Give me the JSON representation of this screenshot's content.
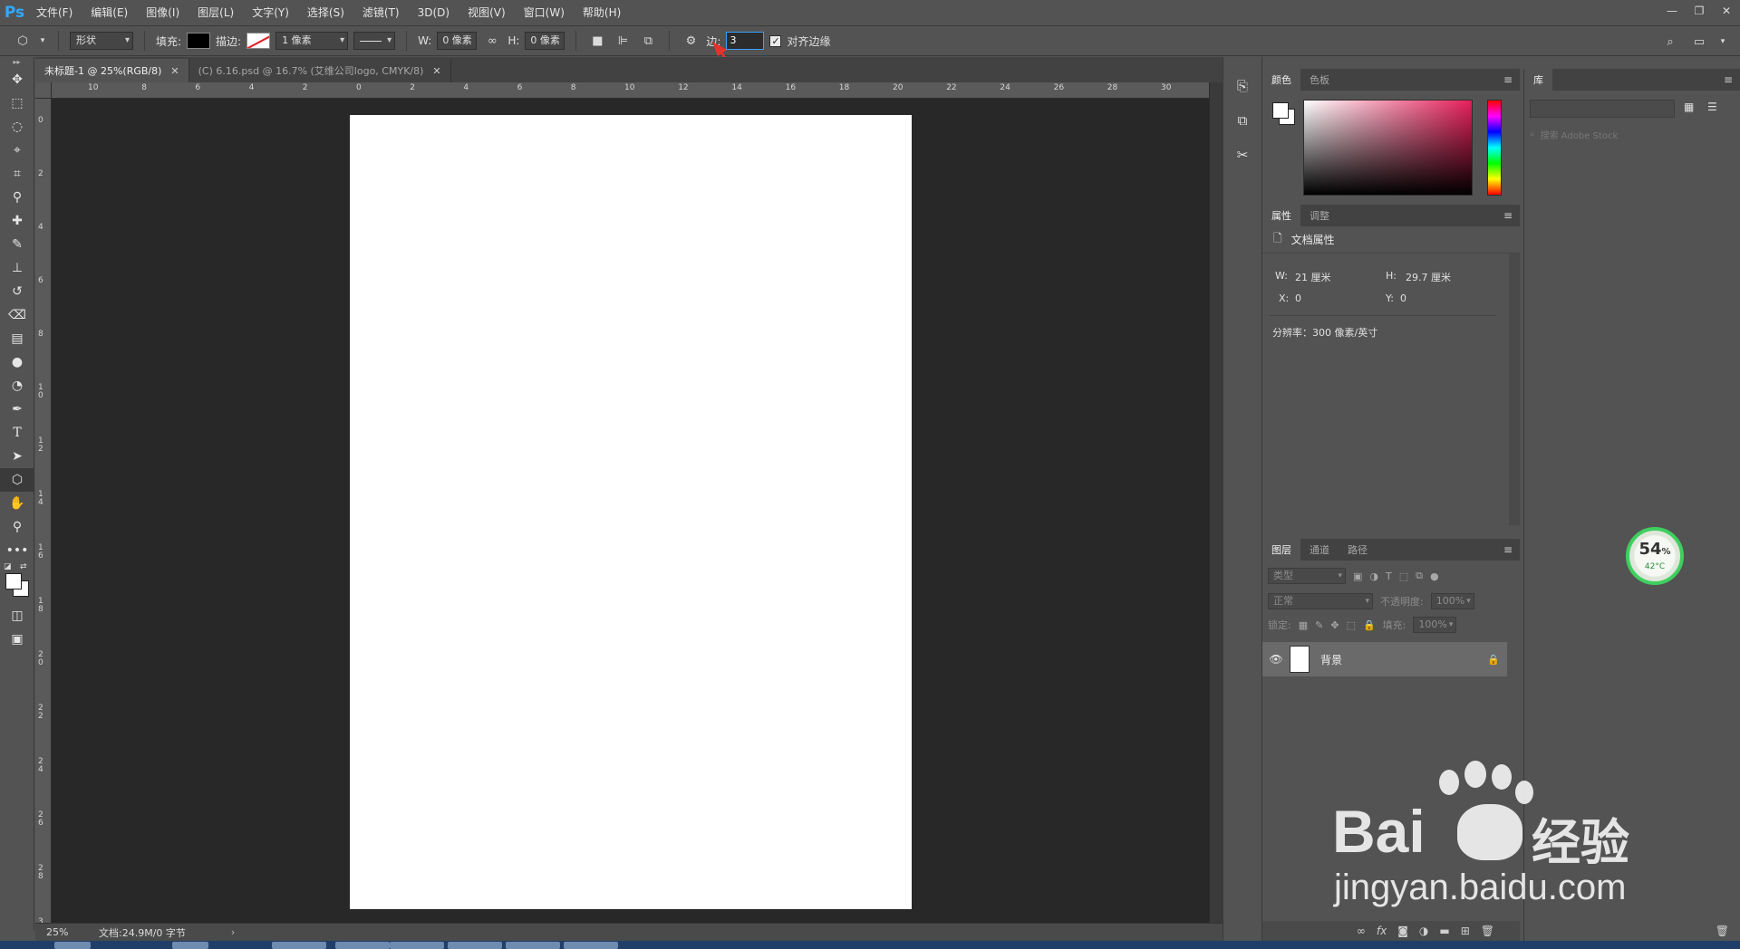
{
  "app": {
    "logo": "Ps",
    "menu": [
      "文件(F)",
      "编辑(E)",
      "图像(I)",
      "图层(L)",
      "文字(Y)",
      "选择(S)",
      "滤镜(T)",
      "3D(D)",
      "视图(V)",
      "窗口(W)",
      "帮助(H)"
    ],
    "window_controls": [
      "minimize-icon",
      "restore-icon",
      "close-icon"
    ]
  },
  "options": {
    "tool_icon": "polygon-tool-icon",
    "mode": "形状",
    "fill_label": "填充:",
    "fill_color": "#000000",
    "stroke_label": "描边:",
    "stroke_width": "1 像素",
    "w_label": "W:",
    "w_value": "0 像素",
    "h_label": "H:",
    "h_value": "0 像素",
    "sides_label": "边:",
    "sides_value": "3",
    "align_edges_label": "对齐边缘",
    "align_edges_checked": true
  },
  "toolbar": {
    "active_tool": "polygon-tool",
    "tools": [
      "move-icon",
      "marquee-icon",
      "lasso-icon",
      "quick-select-icon",
      "crop-icon",
      "eyedropper-icon",
      "healing-brush-icon",
      "brush-icon",
      "clone-stamp-icon",
      "history-brush-icon",
      "eraser-icon",
      "gradient-icon",
      "blur-icon",
      "dodge-icon",
      "pen-icon",
      "type-icon",
      "path-select-icon",
      "polygon-tool-icon",
      "hand-icon",
      "zoom-icon",
      "more-tools-icon"
    ]
  },
  "tabs": [
    {
      "label": "未标题-1 @ 25%(RGB/8)",
      "active": true
    },
    {
      "label": "(C) 6.16.psd @ 16.7% (艾维公司logo, CMYK/8)",
      "active": false
    }
  ],
  "rulers": {
    "top": [
      "10",
      "8",
      "6",
      "4",
      "2",
      "0",
      "2",
      "4",
      "6",
      "8",
      "10",
      "12",
      "14",
      "16",
      "18",
      "20",
      "22",
      "24",
      "26",
      "28",
      "30"
    ],
    "left": [
      "0",
      "2",
      "4",
      "6",
      "8",
      "10",
      "12",
      "14",
      "16",
      "18",
      "20",
      "22",
      "24",
      "26",
      "28",
      "3"
    ]
  },
  "status": {
    "zoom": "25%",
    "doc_info": "文档:24.9M/0 字节"
  },
  "color_panel": {
    "tabs": [
      "颜色",
      "色板"
    ],
    "hue_color": "#e61f5a"
  },
  "properties_panel": {
    "tabs": [
      "属性",
      "调整"
    ],
    "title": "文档属性",
    "w_label": "W:",
    "w_value": "21 厘米",
    "h_label": "H:",
    "h_value": "29.7 厘米",
    "x_label": "X:",
    "x_value": "0",
    "y_label": "Y:",
    "y_value": "0",
    "resolution": "分辨率：300 像素/英寸"
  },
  "layers_panel": {
    "tabs": [
      "图层",
      "通道",
      "路径"
    ],
    "filter_placeholder": "类型",
    "blend_mode": "正常",
    "opacity_label": "不透明度:",
    "opacity_value": "100%",
    "lock_label": "锁定:",
    "fill_label": "填充:",
    "fill_value": "100%",
    "layers": [
      {
        "name": "背景",
        "visible": true,
        "locked": true
      }
    ]
  },
  "library_panel": {
    "tab": "库",
    "search_placeholder": "搜索 Adobe Stock"
  },
  "cpu_widget": {
    "percent": "54",
    "percent_sign": "%",
    "temp": "42°C"
  },
  "watermark": {
    "brand": "Bai",
    "brand2": "经验",
    "url": "jingyan.baidu.com"
  }
}
